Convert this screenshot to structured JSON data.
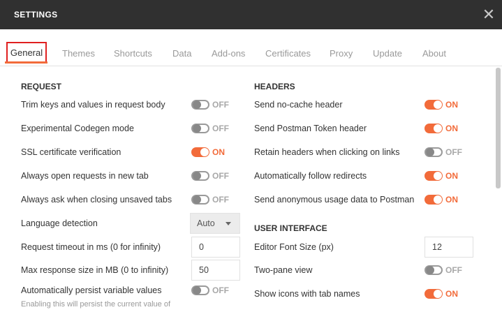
{
  "window": {
    "title": "SETTINGS",
    "close_icon": "close-icon"
  },
  "tabs": [
    {
      "label": "General",
      "active": true
    },
    {
      "label": "Themes"
    },
    {
      "label": "Shortcuts"
    },
    {
      "label": "Data"
    },
    {
      "label": "Add-ons"
    },
    {
      "label": "Certificates"
    },
    {
      "label": "Proxy"
    },
    {
      "label": "Update"
    },
    {
      "label": "About"
    }
  ],
  "request": {
    "heading": "REQUEST",
    "trim_keys": {
      "label": "Trim keys and values in request body",
      "state": "OFF"
    },
    "codegen": {
      "label": "Experimental Codegen mode",
      "state": "OFF"
    },
    "ssl": {
      "label": "SSL certificate verification",
      "state": "ON"
    },
    "new_tab": {
      "label": "Always open requests in new tab",
      "state": "OFF"
    },
    "ask_close": {
      "label": "Always ask when closing unsaved tabs",
      "state": "OFF"
    },
    "language": {
      "label": "Language detection",
      "value": "Auto"
    },
    "timeout": {
      "label": "Request timeout in ms (0 for infinity)",
      "value": "0"
    },
    "max_size": {
      "label": "Max response size in MB (0 to infinity)",
      "value": "50"
    },
    "persist": {
      "label": "Automatically persist variable values",
      "state": "OFF",
      "note": "Enabling this will persist the current value of"
    }
  },
  "headers": {
    "heading": "HEADERS",
    "no_cache": {
      "label": "Send no-cache header",
      "state": "ON"
    },
    "postman_token": {
      "label": "Send Postman Token header",
      "state": "ON"
    },
    "retain": {
      "label": "Retain headers when clicking on links",
      "state": "OFF"
    },
    "redirects": {
      "label": "Automatically follow redirects",
      "state": "ON"
    },
    "anonymous": {
      "label": "Send anonymous usage data to Postman",
      "state": "ON"
    }
  },
  "ui": {
    "heading": "USER INTERFACE",
    "font_size": {
      "label": "Editor Font Size (px)",
      "value": "12"
    },
    "two_pane": {
      "label": "Two-pane view",
      "state": "OFF"
    },
    "tab_icons": {
      "label": "Show icons with tab names",
      "state": "ON"
    }
  },
  "colors": {
    "accent": "#f26b3a",
    "titlebar": "#303030",
    "highlight": "#e02020"
  }
}
